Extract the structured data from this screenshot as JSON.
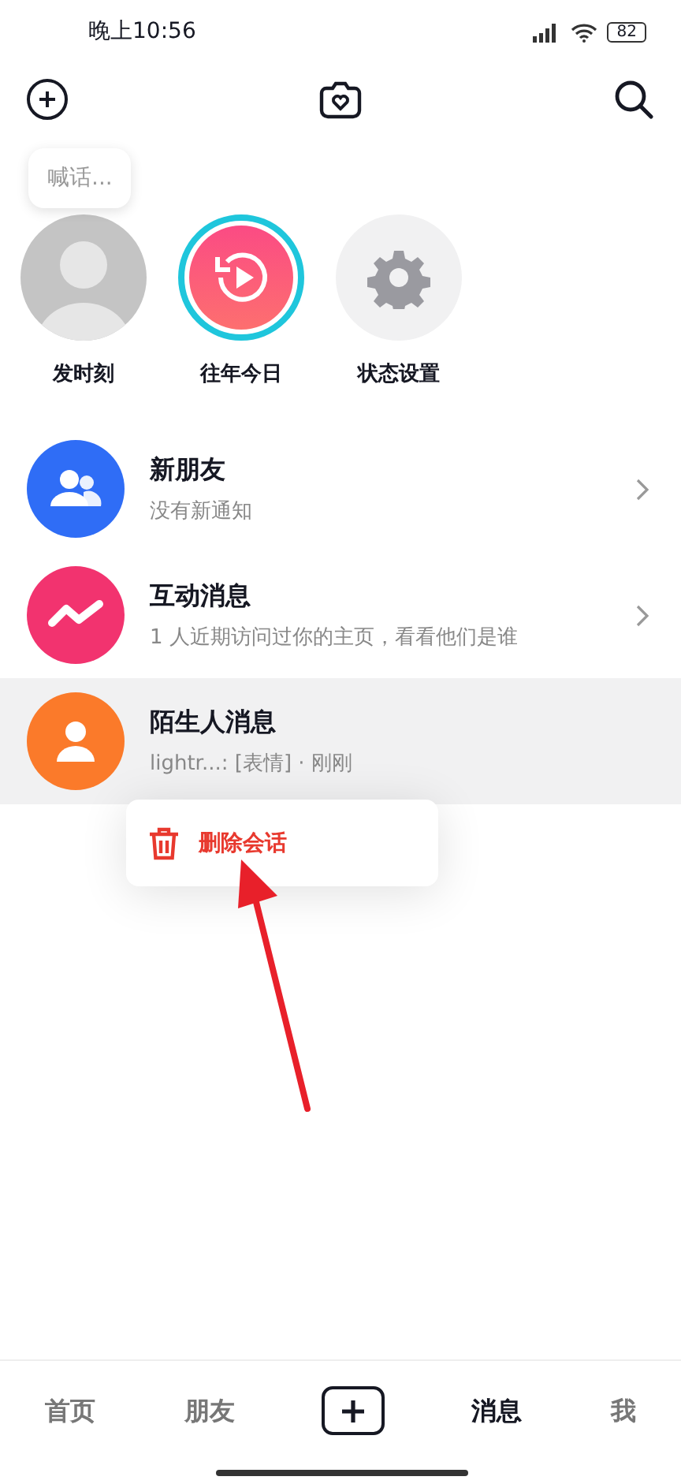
{
  "status_bar": {
    "time": "晚上10:56",
    "battery": "82"
  },
  "stories": {
    "bubble": "喊话...",
    "items": [
      {
        "label": "发时刻",
        "kind": "avatar",
        "ringed": false
      },
      {
        "label": "往年今日",
        "kind": "memories",
        "ringed": true
      },
      {
        "label": "状态设置",
        "kind": "settings",
        "ringed": false
      }
    ]
  },
  "chats": [
    {
      "title": "新朋友",
      "subtitle": "没有新通知",
      "kind": "friends",
      "color": "#2f6df6",
      "chevron": true,
      "selected": false
    },
    {
      "title": "互动消息",
      "subtitle": "1 人近期访问过你的主页，看看他们是谁",
      "kind": "interactions",
      "color": "#f2336f",
      "chevron": true,
      "selected": false
    },
    {
      "title": "陌生人消息",
      "subtitle": "lightr...: [表情] · 刚刚",
      "kind": "strangers",
      "color": "#fb7a2a",
      "chevron": false,
      "selected": true
    }
  ],
  "context_menu": {
    "items": [
      {
        "label": "删除会话",
        "kind": "delete"
      }
    ]
  },
  "tab_bar": {
    "tabs": [
      {
        "label": "首页",
        "kind": "tab",
        "selected": false
      },
      {
        "label": "朋友",
        "kind": "tab",
        "selected": false
      },
      {
        "kind": "create",
        "selected": false
      },
      {
        "label": "消息",
        "kind": "tab",
        "selected": true
      },
      {
        "label": "我",
        "kind": "tab",
        "selected": false
      }
    ]
  }
}
